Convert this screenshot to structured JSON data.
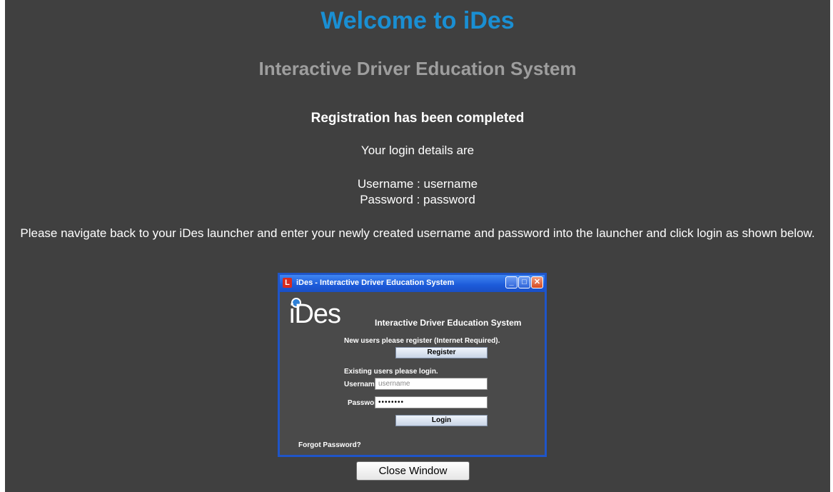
{
  "header": {
    "title": "Welcome to iDes",
    "subtitle": "Interactive Driver Education System"
  },
  "content": {
    "completed": "Registration has been completed",
    "details_intro": "Your login details are",
    "username_line": "Username : username",
    "password_line": "Password : password",
    "instruction": "Please navigate back to your iDes launcher and enter your newly created username and password into the launcher and click login as shown below."
  },
  "launcher": {
    "window_title": "iDes - Interactive Driver Education System",
    "app_icon_glyph": "L",
    "min_glyph": "_",
    "max_glyph": "□",
    "close_glyph": "✕",
    "logo_text": "iDes",
    "heading": "Interactive Driver Education System",
    "new_users_text": "New users please register (Internet Required).",
    "register_label": "Register",
    "existing_users_text": "Existing users please login.",
    "username_label": "Username",
    "username_value": "username",
    "password_label": "Password",
    "password_value": "••••••••",
    "login_label": "Login",
    "forgot_password": "Forgot Password?"
  },
  "footer": {
    "close_button": "Close Window"
  },
  "colors": {
    "background": "#404040",
    "title": "#1a8fd3",
    "subtitle": "#9e9e9e",
    "window_frame": "#1f55c8"
  }
}
